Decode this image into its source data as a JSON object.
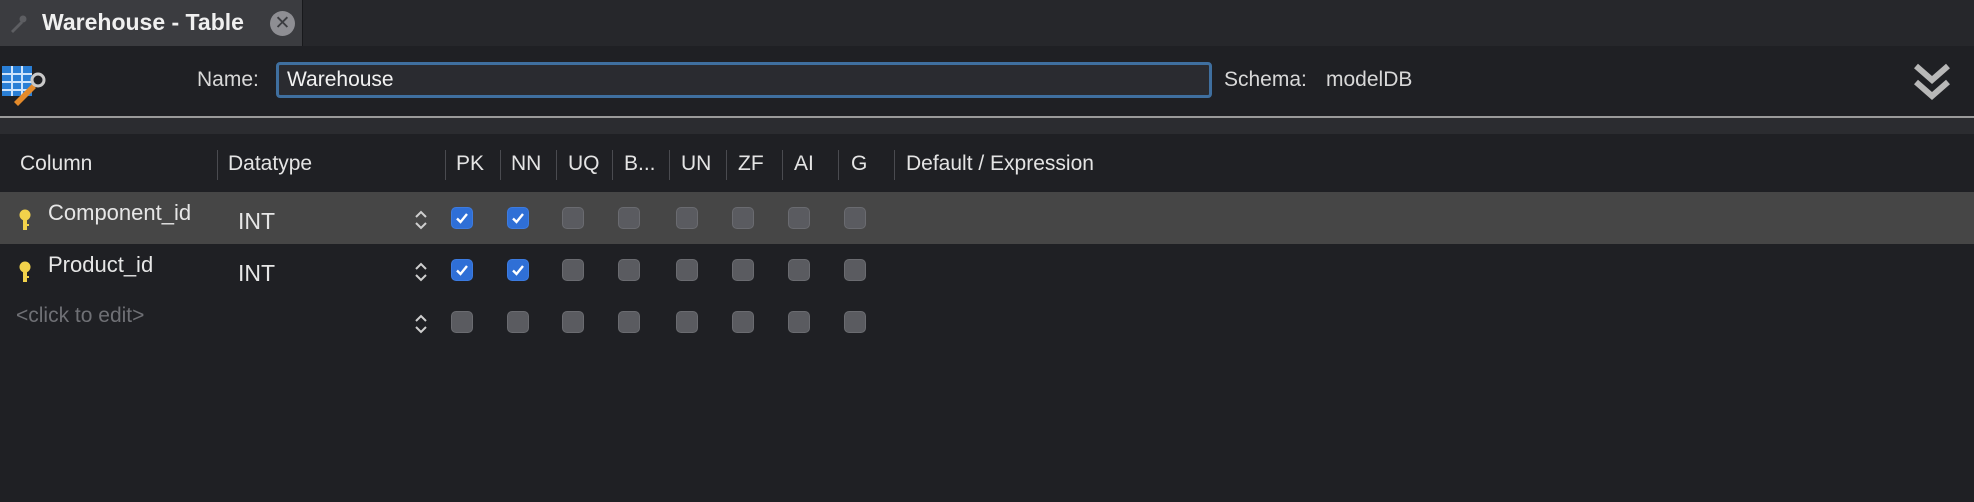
{
  "tab": {
    "title": "Warehouse - Table",
    "close_glyph": "✕",
    "icon": "table-wrench-icon"
  },
  "header": {
    "name_label": "Name:",
    "name_value": "Warehouse",
    "schema_label": "Schema:",
    "schema_value": "modelDB",
    "collapse_icon": "double-chevron-down-icon"
  },
  "grid": {
    "columns": [
      "Column",
      "Datatype",
      "PK",
      "NN",
      "UQ",
      "B...",
      "UN",
      "ZF",
      "AI",
      "G",
      "Default / Expression"
    ],
    "flag_keys": [
      "PK",
      "NN",
      "UQ",
      "B",
      "UN",
      "ZF",
      "AI",
      "G"
    ],
    "rows": [
      {
        "name": "Component_id",
        "type": "INT",
        "key_icon": true,
        "selected": true,
        "flags": [
          true,
          true,
          false,
          false,
          false,
          false,
          false,
          false
        ]
      },
      {
        "name": "Product_id",
        "type": "INT",
        "key_icon": true,
        "selected": false,
        "flags": [
          true,
          true,
          false,
          false,
          false,
          false,
          false,
          false
        ]
      }
    ],
    "new_row_placeholder": "<click to edit>"
  },
  "colors": {
    "checkbox_on": "#2f6fd6",
    "selection": "#3f6f9f",
    "key": "#f2d24b"
  }
}
